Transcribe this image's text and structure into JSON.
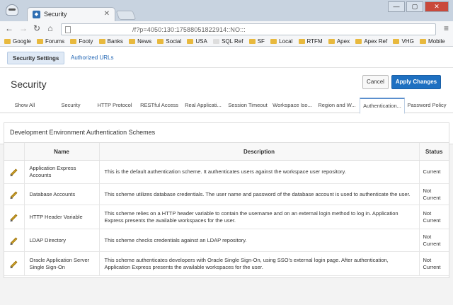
{
  "browser": {
    "tab_title": "Security",
    "tab_close": "✕",
    "url": "/f?p=4050:130:17588051822914::NO:::",
    "controls": [
      "—",
      "▢",
      "✕"
    ],
    "bookmarks": [
      "Google",
      "Forums",
      "Footy",
      "Banks",
      "News",
      "Social",
      "USA",
      "SQL Ref",
      "SF",
      "Local",
      "RTFM",
      "Apex",
      "Apex Ref",
      "VHG",
      "Mobile"
    ]
  },
  "subnav": {
    "security_settings": "Security Settings",
    "authorized_urls": "Authorized URLs"
  },
  "header": {
    "title": "Security",
    "cancel": "Cancel",
    "apply": "Apply Changes"
  },
  "tabs": [
    "Show All",
    "Security",
    "HTTP Protocol",
    "RESTful Access",
    "Real Applicati...",
    "Session Timeout",
    "Workspace Iso...",
    "Region and W...",
    "Authentication...",
    "Password Policy"
  ],
  "region": {
    "title": "Development Environment Authentication Schemes",
    "columns": {
      "name": "Name",
      "description": "Description",
      "status": "Status"
    },
    "rows": [
      {
        "name": "Application Express Accounts",
        "description": "This is the default authentication scheme. It authenticates users against the workspace user repository.",
        "status": "Current"
      },
      {
        "name": "Database Accounts",
        "description": "This scheme utilizes database credentials. The user name and password of the database account is used to authenticate the user.",
        "status": "Not Current"
      },
      {
        "name": "HTTP Header Variable",
        "description": "This scheme relies on a HTTP header variable to contain the username and on an external login method to log in. Application Express presents the available workspaces for the user.",
        "status": "Not Current"
      },
      {
        "name": "LDAP Directory",
        "description": "This scheme checks credentials against an LDAP repository.",
        "status": "Not Current"
      },
      {
        "name": "Oracle Application Server Single Sign-On",
        "description": "This scheme authenticates developers with Oracle Single Sign-On, using SSO's external login page. After authentication, Application Express presents the available workspaces for the user.",
        "status": "Not Current"
      }
    ]
  }
}
